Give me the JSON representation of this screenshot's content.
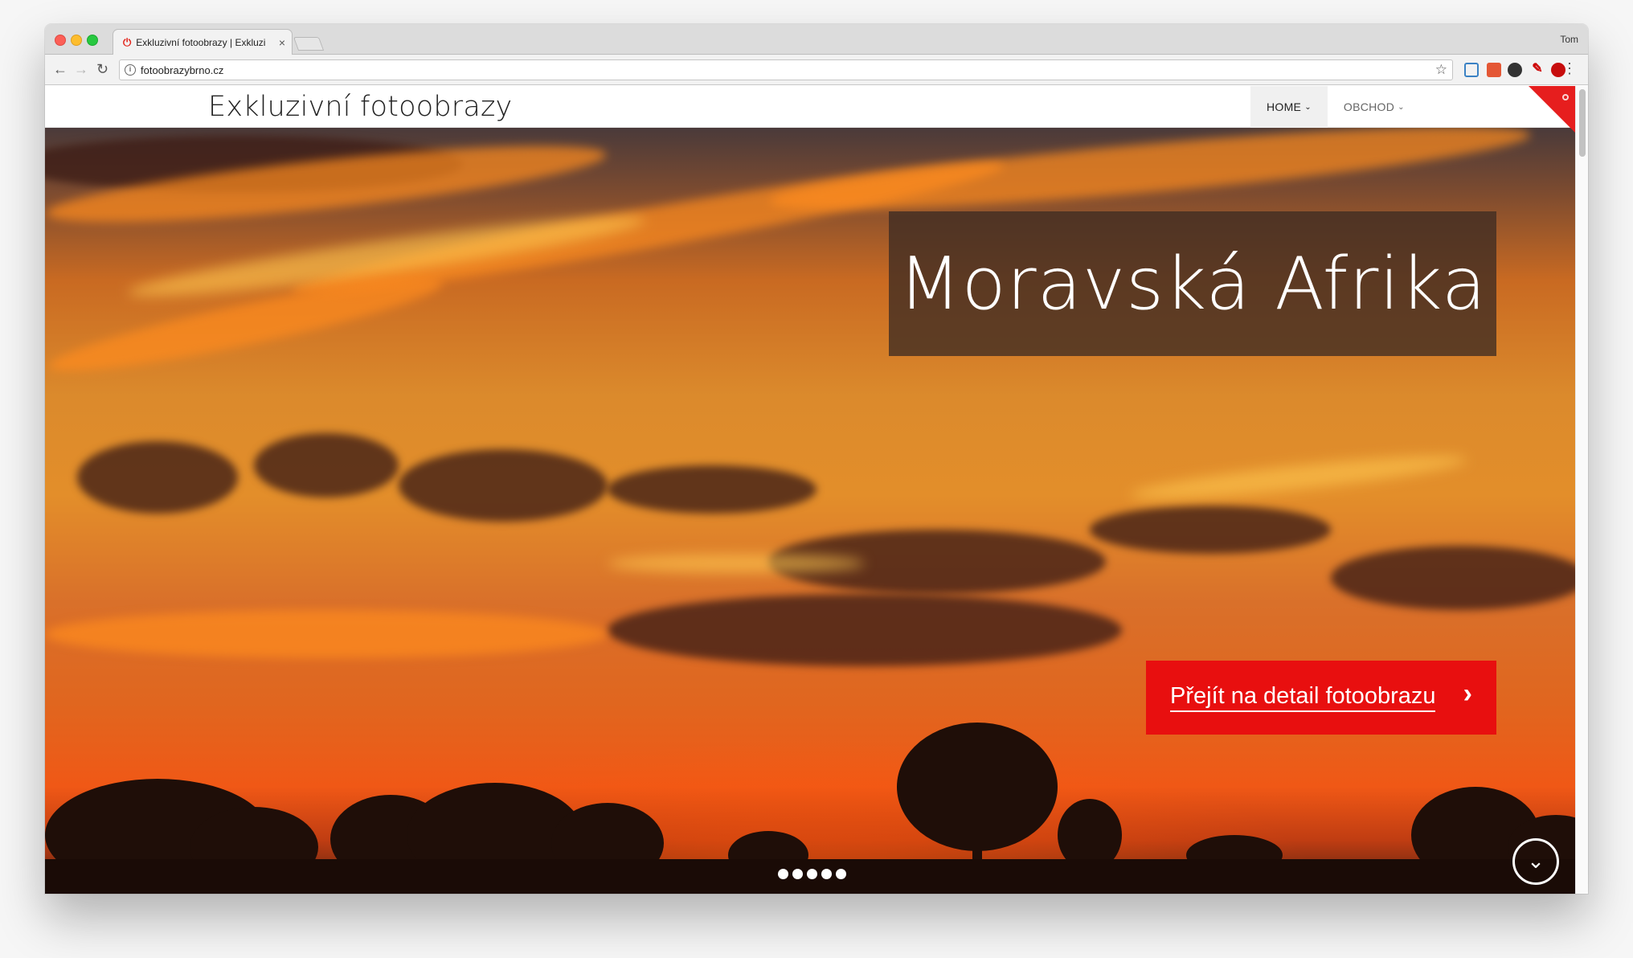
{
  "browser": {
    "tab_title": "Exkluzivní fotoobrazy | Exkluzi",
    "tab_close": "×",
    "profile_name": "Tom",
    "url": "fotoobrazybrno.cz"
  },
  "site": {
    "title": "Exkluzivní fotoobrazy",
    "nav": [
      {
        "label": "HOME",
        "active": true
      },
      {
        "label": "OBCHOD",
        "active": false
      }
    ]
  },
  "hero": {
    "photo_title": "Moravská Afrika",
    "cta_label": "Přejít na detail fotoobrazu",
    "slide_count": 5,
    "active_slide": 1
  },
  "icons": {
    "back": "arrow-left-icon",
    "forward": "arrow-right-icon",
    "reload": "reload-icon",
    "info": "info-icon",
    "bookmark": "star-icon",
    "menu": "more-vertical-icon",
    "scroll": "chevron-down-icon",
    "cta": "chevron-right-icon"
  },
  "colors": {
    "accent_red": "#e80f0f",
    "title_box": "#3e2c22"
  }
}
